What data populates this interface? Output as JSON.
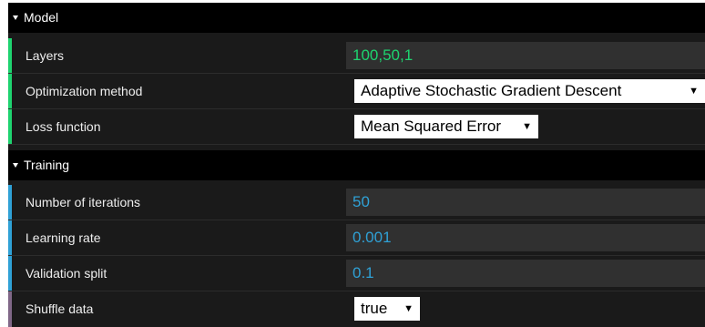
{
  "model": {
    "header": "Model",
    "rows": {
      "layers": {
        "label": "Layers",
        "value": "100,50,1"
      },
      "optimization": {
        "label": "Optimization method",
        "value": "Adaptive Stochastic Gradient Descent"
      },
      "loss": {
        "label": "Loss function",
        "value": "Mean Squared Error"
      }
    }
  },
  "training": {
    "header": "Training",
    "rows": {
      "iterations": {
        "label": "Number of iterations",
        "value": "50"
      },
      "learning_rate": {
        "label": "Learning rate",
        "value": "0.001"
      },
      "validation_split": {
        "label": "Validation split",
        "value": "0.1"
      },
      "shuffle": {
        "label": "Shuffle data",
        "value": "true"
      }
    }
  },
  "icons": {
    "collapse": "caret-down-icon",
    "select": "dropdown-arrow-icon"
  },
  "colors": {
    "string_stripe": "#1ed36f",
    "number_stripe": "#2fa1d6",
    "boolean_stripe": "#806787",
    "text_value": "#1ed36f",
    "number_value": "#2fa1d6"
  }
}
